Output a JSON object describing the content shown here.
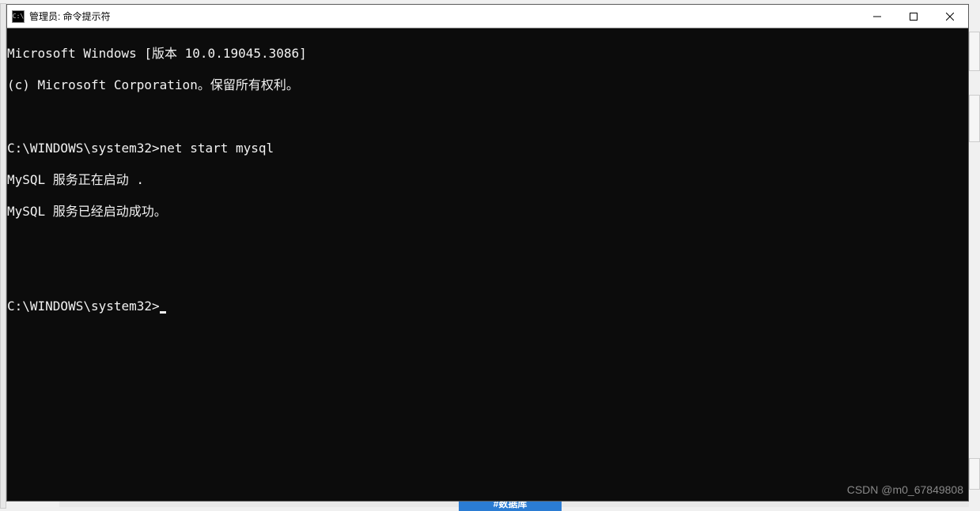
{
  "window": {
    "title": "管理员: 命令提示符",
    "icon_label": "C:\\"
  },
  "terminal": {
    "lines": [
      "Microsoft Windows [版本 10.0.19045.3086]",
      "(c) Microsoft Corporation。保留所有权利。",
      "",
      "C:\\WINDOWS\\system32>net start mysql",
      "MySQL 服务正在启动 .",
      "MySQL 服务已经启动成功。",
      "",
      "",
      "C:\\WINDOWS\\system32>"
    ]
  },
  "watermark": "CSDN @m0_67849808",
  "bg_blue_text": "#数据库"
}
